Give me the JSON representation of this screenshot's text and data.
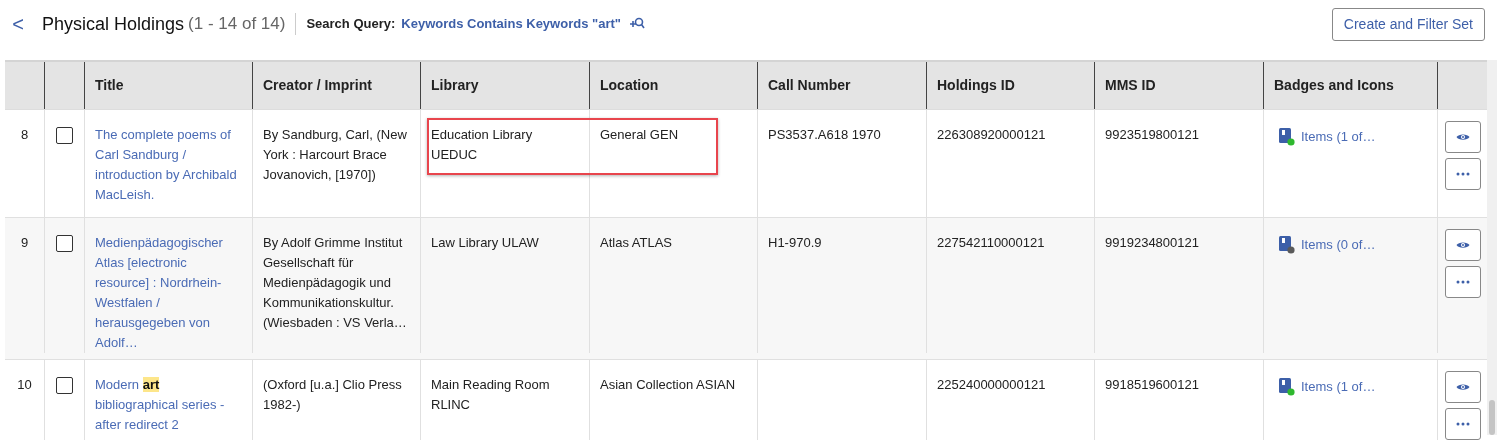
{
  "header": {
    "back": "<",
    "title": "Physical Holdings",
    "count": "(1 - 14 of 14)",
    "query_label": "Search Query:",
    "query": "Keywords Contains Keywords \"art\"",
    "button": "Create and Filter Set"
  },
  "table": {
    "columns": [
      "Title",
      "Creator / Imprint",
      "Library",
      "Location",
      "Call Number",
      "Holdings ID",
      "MMS ID",
      "Badges and Icons"
    ],
    "rows": [
      {
        "number": "8",
        "checked": false,
        "highlighted": true,
        "title": "The complete poems of Carl Sandburg / introduction by Archibald MacLeish.",
        "creator": "By Sandburg, Carl, (New York : Harcourt Brace Jovanovich, [1970])",
        "library": "Education Library UEDUC",
        "location": "General GEN",
        "call_number": "PS3537.A618 1970",
        "holdings_id": "226308920000121",
        "mms_id": "9923519800121",
        "items": "Items (1 of…",
        "color": "#2eb82e"
      },
      {
        "number": "9",
        "checked": false,
        "highlighted": false,
        "title": "Medienpädagogischer Atlas [electronic resource] : Nordrhein-Westfalen / herausgegeben von Adolf…",
        "creator": "By Adolf Grimme Institut Gesellschaft für Medienpädagogik und Kommunikationskultur. (Wiesbaden : VS Verla…",
        "library": "Law Library ULAW",
        "location": "Atlas ATLAS",
        "call_number": "H1-970.9",
        "holdings_id": "227542110000121",
        "mms_id": "9919234800121",
        "items": "Items (0 of…",
        "color": "#5a5a5a"
      },
      {
        "number": "10",
        "checked": false,
        "highlighted": false,
        "title": "Modern **art** bibliographical series - after redirect 2",
        "creator": "(Oxford [u.a.] Clio Press 1982-)",
        "library": "Main Reading Room RLINC",
        "location": "Asian Collection ASIAN",
        "holdings_id": "225240000000121",
        "mms_id": "9918519600121",
        "items": "Items (1 of…",
        "color": "#2eb82e"
      }
    ]
  }
}
